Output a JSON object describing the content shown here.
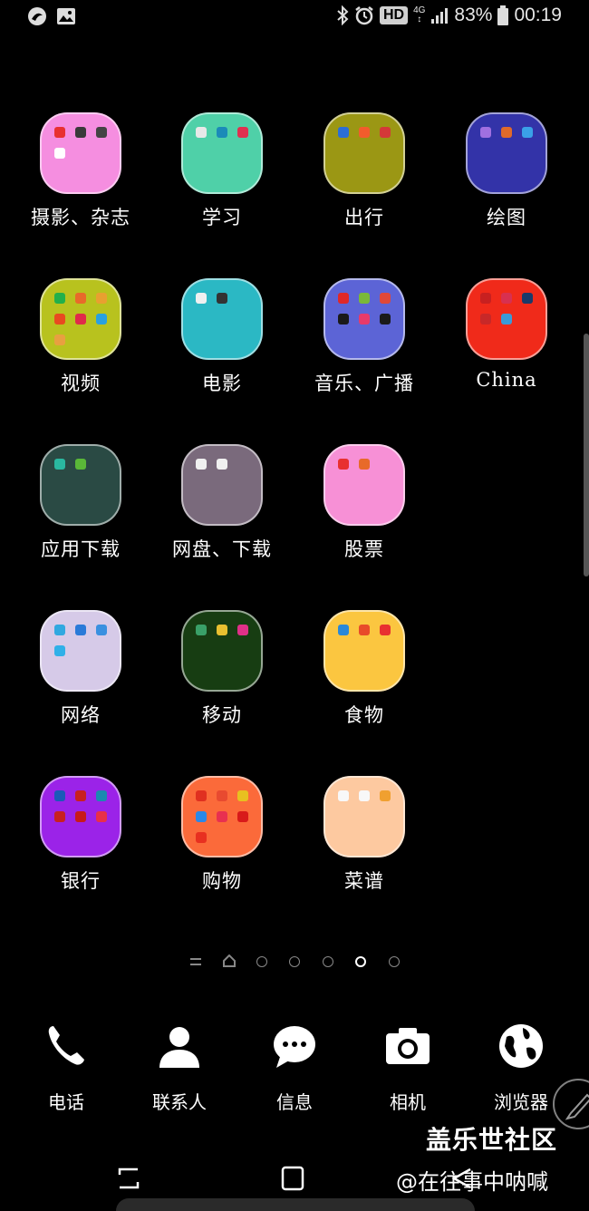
{
  "status_bar": {
    "hd": "HD",
    "network": "4G",
    "battery": "83%",
    "time": "00:19",
    "left_icons": [
      "swirl-app-icon",
      "gallery-icon"
    ],
    "right_icons": [
      "bluetooth-icon",
      "alarm-icon",
      "signal-icon",
      "battery-icon"
    ]
  },
  "folders": [
    {
      "label": "摄影、杂志",
      "color": "#f58ee0",
      "minis": [
        "#e83030",
        "#3a3a3a",
        "#444",
        "#fff"
      ]
    },
    {
      "label": "学习",
      "color": "#4fd0a8",
      "minis": [
        "#e8e8e8",
        "#1b8ab8",
        "#e03050"
      ]
    },
    {
      "label": "出行",
      "color": "#9b9714",
      "minis": [
        "#2a6ed8",
        "#f25c2c",
        "#d43838"
      ]
    },
    {
      "label": "绘图",
      "color": "#3333a8",
      "minis": [
        "#a070e0",
        "#e06a2a",
        "#3aa0e8"
      ]
    },
    {
      "label": "视频",
      "color": "#b8c21e",
      "minis": [
        "#22b04a",
        "#e86a2a",
        "#e8a030",
        "#e84a20",
        "#e02a4a",
        "#2aa0e0",
        "#e8a040"
      ]
    },
    {
      "label": "电影",
      "color": "#2bb8c4",
      "minis": [
        "#f0f0f0",
        "#333"
      ]
    },
    {
      "label": "音乐、广播",
      "color": "#5c64d6",
      "minis": [
        "#e02828",
        "#7ab838",
        "#e04838",
        "#1a1a1a",
        "#e83a6a",
        "#1a1a1a"
      ]
    },
    {
      "label": "China",
      "color": "#f02a1a",
      "minis": [
        "#c82020",
        "#d83050",
        "#1a3a6a",
        "#c82828",
        "#3a9ad8"
      ]
    },
    {
      "label": "应用下载",
      "color": "#2a4a44",
      "minis": [
        "#2ab8a0",
        "#5ab838"
      ]
    },
    {
      "label": "网盘、下载",
      "color": "#7a6a7c",
      "minis": [
        "#f0f0f0",
        "#f0f0f0"
      ]
    },
    {
      "label": "股票",
      "color": "#f790d6",
      "minis": [
        "#e83030",
        "#e86a2a"
      ]
    },
    {
      "label": "网络",
      "color": "#d6cae8",
      "minis": [
        "#30a8e0",
        "#2a7ad8",
        "#3a90e0",
        "#30b0e8"
      ]
    },
    {
      "label": "移动",
      "color": "#173d12",
      "minis": [
        "#3aa068",
        "#e8c030",
        "#e03088"
      ]
    },
    {
      "label": "食物",
      "color": "#fbc640",
      "minis": [
        "#2a88d8",
        "#e84a2a",
        "#e83030"
      ]
    },
    {
      "label": "银行",
      "color": "#9b23e8",
      "minis": [
        "#1a5ab8",
        "#c82020",
        "#1a8ab0",
        "#c82020",
        "#c81a1a",
        "#e8304a"
      ]
    },
    {
      "label": "购物",
      "color": "#fb6a3a",
      "minis": [
        "#e03020",
        "#e84a30",
        "#e8c020",
        "#2a88e8",
        "#e83050",
        "#d81a1a",
        "#e83020"
      ]
    },
    {
      "label": "菜谱",
      "color": "#fdc9a0",
      "minis": [
        "#f8f8f8",
        "#f8f8f8",
        "#f0a030"
      ]
    }
  ],
  "pager": {
    "pages": 7,
    "active_index": 5
  },
  "dock": [
    {
      "label": "电话",
      "icon": "phone-icon"
    },
    {
      "label": "联系人",
      "icon": "contact-icon"
    },
    {
      "label": "信息",
      "icon": "message-icon"
    },
    {
      "label": "相机",
      "icon": "camera-icon"
    },
    {
      "label": "浏览器",
      "icon": "globe-icon"
    }
  ],
  "watermark": {
    "title": "盖乐世社区",
    "subtitle": "@在往事中呐喊"
  }
}
